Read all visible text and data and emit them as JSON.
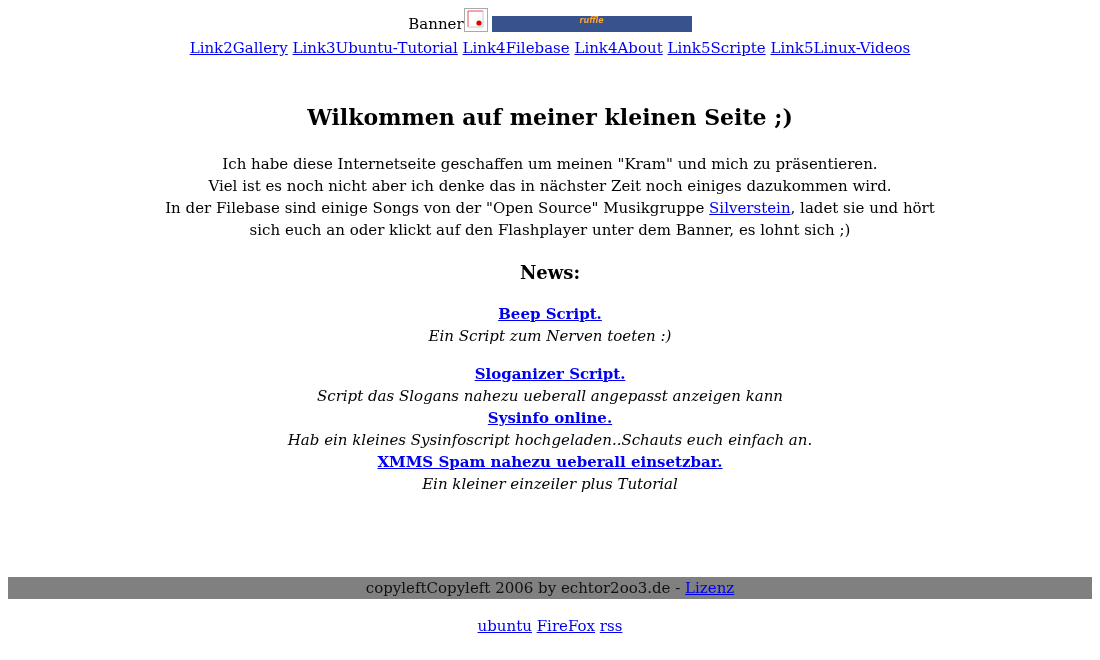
{
  "header": {
    "banner_text": "Banner",
    "player": {
      "logo": "ruffle"
    }
  },
  "nav": {
    "links": [
      "Link2Gallery",
      "Link3Ubuntu-Tutorial",
      "Link4Filebase",
      "Link4About",
      "Link5Scripte",
      "Link5Linux-Videos"
    ]
  },
  "intro": {
    "title": "Wilkommen auf meiner kleinen Seite ;)",
    "lines": [
      {
        "segments": [
          {
            "kind": "text",
            "text": "Ich habe diese Internetseite geschaffen um meinen \"Kram\" und mich zu präsentieren."
          }
        ]
      },
      {
        "segments": [
          {
            "kind": "text",
            "text": "Viel ist es noch nicht aber ich denke das in nächster Zeit noch einiges dazukommen wird."
          }
        ]
      },
      {
        "segments": [
          {
            "kind": "text",
            "text": "In der Filebase sind einige Songs von der \"Open Source\" Musikgruppe"
          },
          {
            "kind": "link",
            "text": "Silverstein"
          },
          {
            "kind": "text",
            "text": ", ladet sie und hört"
          }
        ]
      },
      {
        "segments": [
          {
            "kind": "text",
            "text": "sich euch an oder klickt auf den Flashplayer unter dem Banner, es lohnt sich ;)"
          }
        ]
      }
    ]
  },
  "news": {
    "heading": "News:",
    "groups": [
      {
        "items": [
          {
            "title": "Beep Script.",
            "description": "Ein Script zum Nerven toeten :)"
          }
        ]
      },
      {
        "items": [
          {
            "title": "Sloganizer Script.",
            "description": "Script das Slogans nahezu ueberall angepasst anzeigen kann"
          },
          {
            "title": "Sysinfo online.",
            "description": "Hab ein kleines Sysinfoscript hochgeladen..Schauts euch einfach an."
          },
          {
            "title": "XMMS Spam nahezu ueberall einsetzbar.",
            "description": "Ein kleiner einzeiler plus Tutorial"
          }
        ]
      }
    ]
  },
  "footer": {
    "text": "copyleftCopyleft 2006 by echtor2oo3.de -",
    "license_link": "Lizenz",
    "links": [
      "ubuntu",
      "FireFox",
      "rss"
    ]
  }
}
